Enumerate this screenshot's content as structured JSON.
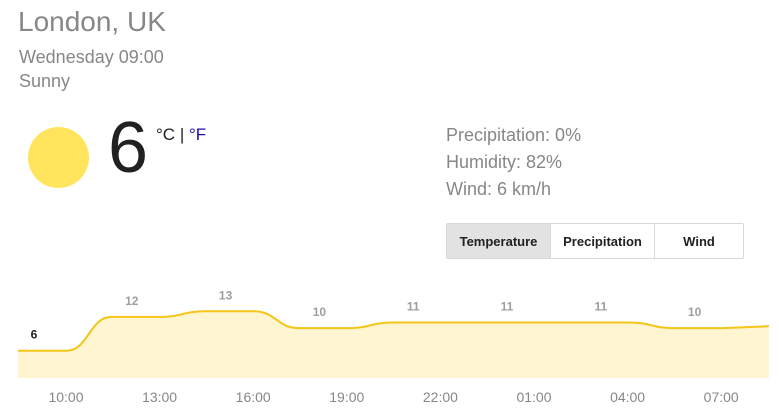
{
  "location": "London, UK",
  "datetime": "Wednesday 09:00",
  "condition": "Sunny",
  "icon": "sun-icon",
  "current_temp": "6",
  "units": {
    "celsius": "°C",
    "separator": "|",
    "fahrenheit": "°F"
  },
  "details": {
    "precipitation": "Precipitation: 0%",
    "humidity": "Humidity: 82%",
    "wind": "Wind: 6 km/h"
  },
  "tabs": [
    {
      "label": "Temperature",
      "selected": true
    },
    {
      "label": "Precipitation",
      "selected": false
    },
    {
      "label": "Wind",
      "selected": false
    }
  ],
  "colors": {
    "line": "#f5c518",
    "fill": "#fff6d1",
    "sun": "#ffe45c",
    "link": "#1a0dab"
  },
  "chart_data": {
    "type": "area",
    "x": [
      "10:00",
      "13:00",
      "16:00",
      "19:00",
      "22:00",
      "01:00",
      "04:00",
      "07:00"
    ],
    "values": [
      6,
      12,
      13,
      10,
      11,
      11,
      11,
      10
    ],
    "ylim": [
      4,
      15
    ]
  }
}
